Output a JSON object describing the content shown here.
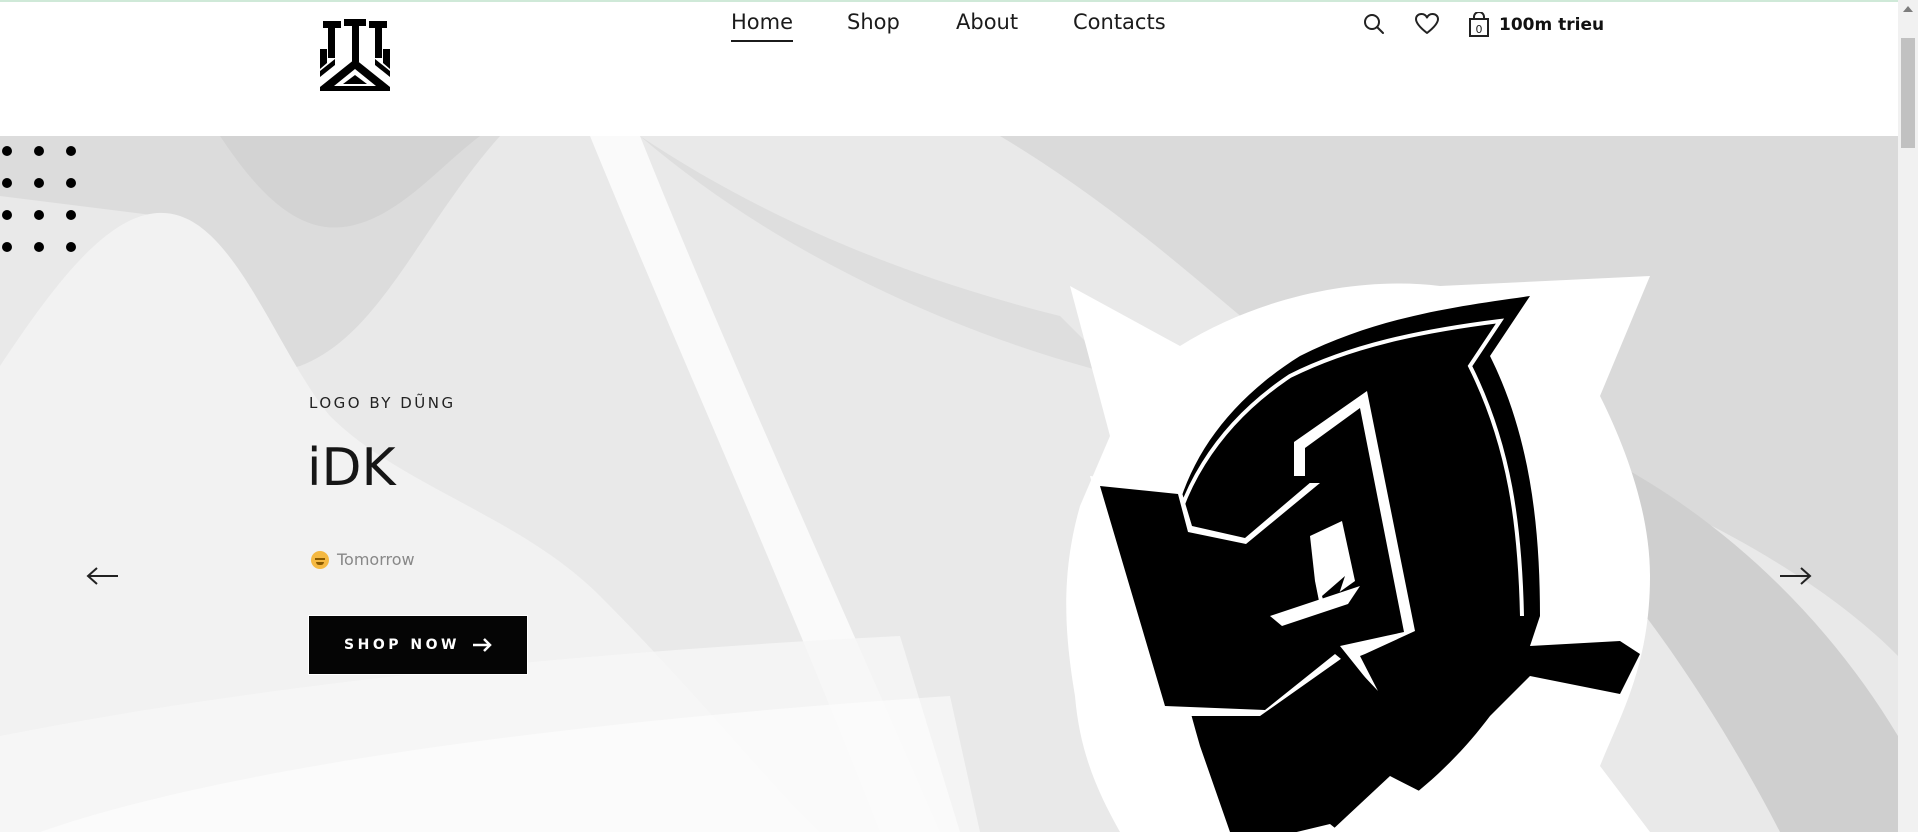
{
  "header": {
    "logo": "jl-monogram-logo",
    "nav": [
      {
        "label": "Home",
        "active": true
      },
      {
        "label": "Shop",
        "active": false
      },
      {
        "label": "About",
        "active": false
      },
      {
        "label": "Contacts",
        "active": false
      }
    ],
    "tools": {
      "search_icon": "search-icon",
      "wishlist_icon": "heart-icon",
      "cart_icon": "shopping-bag-icon",
      "cart_count": "0",
      "cart_total": "100m trieu"
    }
  },
  "hero": {
    "subtitle": "LOGO BY DŨNG",
    "title": "iDK",
    "date_icon": "grinning-face-emoji",
    "date": "Tomorrow",
    "cta_label": "SHOP NOW",
    "cta_icon": "arrow-right-icon",
    "prev_icon": "arrow-left-icon",
    "next_icon": "arrow-right-icon",
    "image": "ninja-mascot-illustration"
  },
  "colors": {
    "accent": "#000000",
    "hero_background": "#ececec",
    "muted_text": "#888888"
  }
}
